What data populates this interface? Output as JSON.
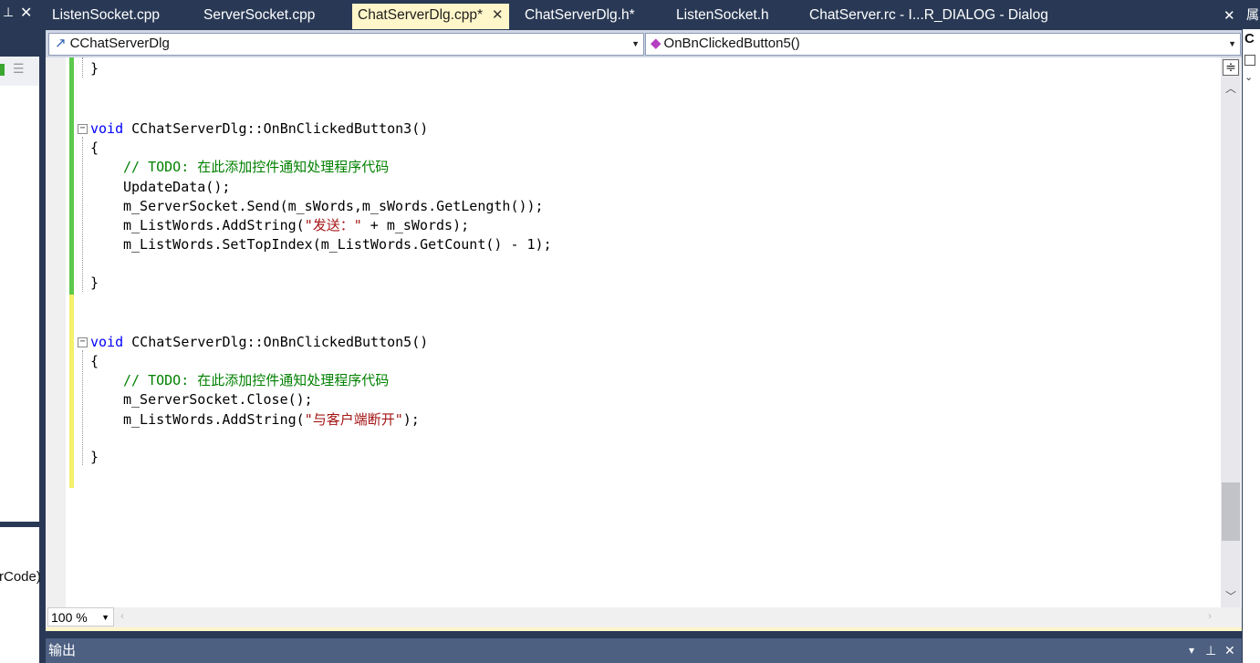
{
  "tabs": [
    {
      "label": "ListenSocket.cpp",
      "active": false
    },
    {
      "label": "ServerSocket.cpp",
      "active": false
    },
    {
      "label": "ChatServerDlg.cpp*",
      "active": true
    },
    {
      "label": "ChatServerDlg.h*",
      "active": false
    },
    {
      "label": "ListenSocket.h",
      "active": false
    },
    {
      "label": "ChatServer.rc - I...R_DIALOG - Dialog",
      "active": false
    }
  ],
  "left_panel": {
    "pin_icon": "pin-icon",
    "close_label": "✕",
    "code_fragment": "rCode)"
  },
  "navigation": {
    "class_combo": "CChatServerDlg",
    "member_combo": "OnBnClickedButton5()"
  },
  "code": {
    "line1": "}",
    "fn3_sig_type": "void",
    "fn3_sig_name": " CChatServerDlg::OnBnClickedButton3()",
    "fn3_open": "{",
    "fn3_comment": "// TODO: 在此添加控件通知处理程序代码",
    "fn3_l1": "UpdateData();",
    "fn3_l2": "m_ServerSocket.Send(m_sWords,m_sWords.GetLength());",
    "fn3_l3_a": "m_ListWords.AddString(",
    "fn3_l3_str": "\"发送：\"",
    "fn3_l3_b": " + m_sWords);",
    "fn3_l4": "m_ListWords.SetTopIndex(m_ListWords.GetCount() - 1);",
    "fn3_close": "}",
    "fn5_sig_type": "void",
    "fn5_sig_name": " CChatServerDlg::OnBnClickedButton5()",
    "fn5_open": "{",
    "fn5_comment": "// TODO: 在此添加控件通知处理程序代码",
    "fn5_l1": "m_ServerSocket.Close();",
    "fn5_l2_a": "m_ListWords.AddString(",
    "fn5_l2_str": "\"与客户端断开\"",
    "fn5_l2_b": ");",
    "fn5_close": "}"
  },
  "zoom": {
    "value": "100 %"
  },
  "output_panel": {
    "title": "输出"
  },
  "right_panel": {
    "label": "属",
    "letter": "C"
  },
  "colors": {
    "keyword": "#0000ff",
    "comment": "#008000",
    "string": "#a31515",
    "saved_bar": "#5cc84d",
    "unsaved_bar": "#f3f06a",
    "chrome": "#293955"
  }
}
